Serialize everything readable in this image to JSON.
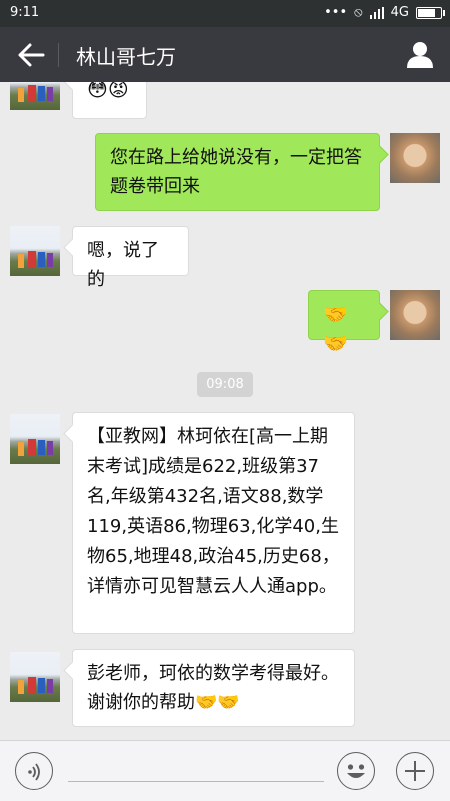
{
  "status": {
    "time": "9:11",
    "network": "4G"
  },
  "header": {
    "title": "林山哥七万"
  },
  "messages": {
    "partial_emoji": "😳😡",
    "m1": "您在路上给她说没有，一定把答题卷带回来",
    "m2": "嗯，说了的",
    "m3": "🤝🤝",
    "timestamp": "09:08",
    "m4": "【亚教网】林珂依在[高一上期末考试]成绩是622,班级第37名,年级第432名,语文88,数学119,英语86,物理63,化学40,生物65,地理48,政治45,历史68，详情亦可见智慧云人人通app。",
    "m5": "彭老师，珂依的数学考得最好。谢谢你的帮助🤝🤝"
  },
  "colors": {
    "topbar": "#393a3f",
    "chat_bg": "#ebebeb",
    "sent_bubble": "#a0e75a",
    "received_bubble": "#ffffff"
  },
  "icons": [
    "back-arrow-icon",
    "profile-icon",
    "voice-icon",
    "emoji-icon",
    "plus-icon"
  ]
}
